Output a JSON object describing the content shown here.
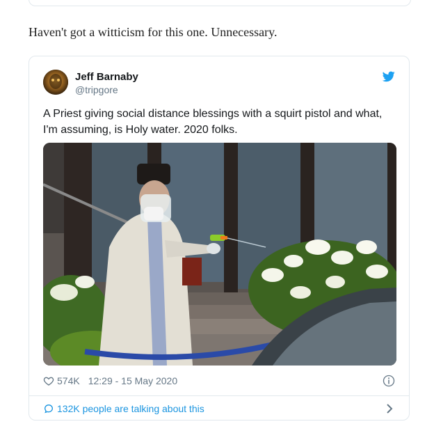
{
  "caption": "Haven't got a witticism for this one. Unnecessary.",
  "tweet": {
    "author_name": "Jeff Barnaby",
    "author_handle": "@tripgore",
    "text": "A Priest giving social distance blessings with a squirt pistol and what, I'm assuming, is Holy water. 2020 folks.",
    "likes": "574K",
    "timestamp": "12:29 - 15 May 2020",
    "conversation": "132K people are talking about this",
    "icons": {
      "brand": "twitter-bird-icon",
      "like": "heart-icon",
      "info": "info-icon",
      "reply": "speech-bubble-icon",
      "more": "chevron-right-icon"
    },
    "colors": {
      "brand": "#1da1f2",
      "link": "#1b95e0",
      "muted": "#657786",
      "border": "#e1e8ed"
    }
  }
}
